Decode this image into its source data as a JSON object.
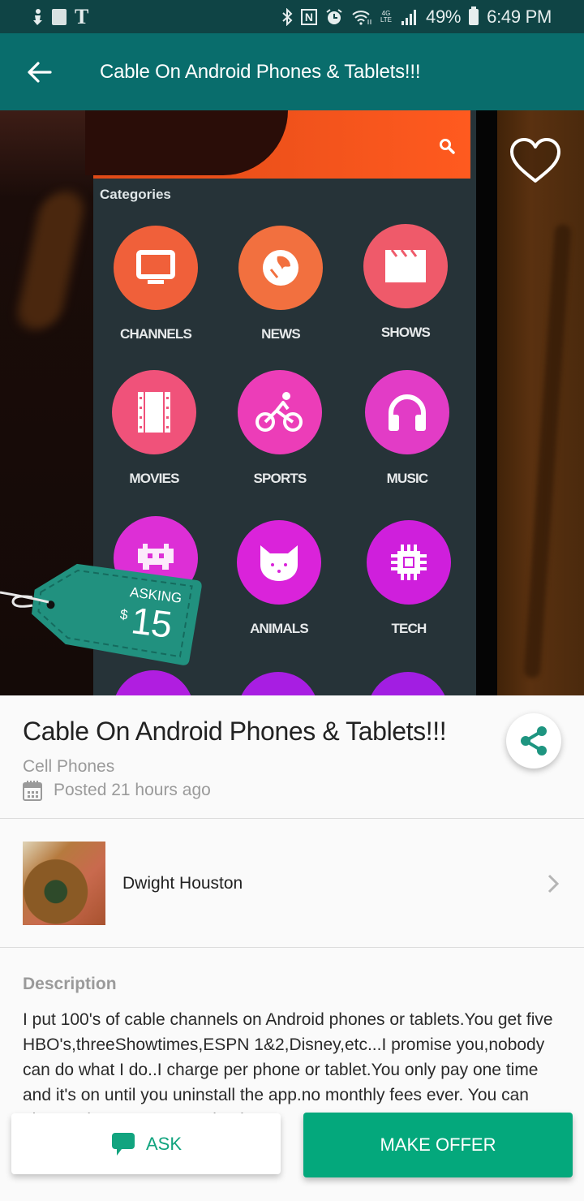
{
  "status_bar": {
    "left_icons": [
      "download-icon",
      "notification-box-icon",
      "t-mobile-icon"
    ],
    "right_icons": [
      "bluetooth-icon",
      "nfc-icon",
      "alarm-icon",
      "wifi-icon",
      "4g-lte-icon",
      "signal-icon"
    ],
    "battery_percent": "49%",
    "time": "6:49 PM"
  },
  "app_bar": {
    "back_icon": "arrow-left-icon",
    "title": "Cable On Android Phones & Tablets!!!"
  },
  "hero": {
    "favorite_icon": "heart-outline-icon",
    "phone_screen": {
      "section_title": "Categories",
      "categories": [
        {
          "label": "CHANNELS",
          "icon": "tv-icon",
          "color": "#f0603a"
        },
        {
          "label": "NEWS",
          "icon": "globe-icon",
          "color": "#f2703f"
        },
        {
          "label": "SHOWS",
          "icon": "clapperboard-icon",
          "color": "#ef5a6a"
        },
        {
          "label": "MOVIES",
          "icon": "film-icon",
          "color": "#f0527a"
        },
        {
          "label": "SPORTS",
          "icon": "bicycle-icon",
          "color": "#ec3db8"
        },
        {
          "label": "MUSIC",
          "icon": "headphones-icon",
          "color": "#e23cc6"
        },
        {
          "label": "",
          "icon": "game-invader-icon",
          "color": "#dd2fd6"
        },
        {
          "label": "ANIMALS",
          "icon": "cat-icon",
          "color": "#da23da"
        },
        {
          "label": "TECH",
          "icon": "chip-icon",
          "color": "#cf1fdc"
        }
      ]
    },
    "price_tag": {
      "label": "ASKING",
      "currency": "$",
      "amount": "15",
      "color": "#21917f"
    }
  },
  "listing": {
    "title": "Cable On Android Phones & Tablets!!!",
    "category": "Cell Phones",
    "posted": "Posted 21 hours ago",
    "share_icon": "share-icon"
  },
  "seller": {
    "name": "Dwight Houston"
  },
  "description": {
    "label": "Description",
    "text": "I put 100's of cable channels on Android phones or tablets.You get five HBO's,threeShowtimes,ESPN 1&2,Disney,etc...I promise you,nobody can do what I do..I charge per phone or tablet.You only pay one time and it's on until you uninstall the app.no monthly fees ever. You can also put it on your TV and enjoy..."
  },
  "actions": {
    "ask_label": "ASK",
    "make_offer_label": "MAKE OFFER"
  },
  "colors": {
    "accent": "#04a87c",
    "app_bar": "#096d6c",
    "status_bar": "#0f4445"
  }
}
